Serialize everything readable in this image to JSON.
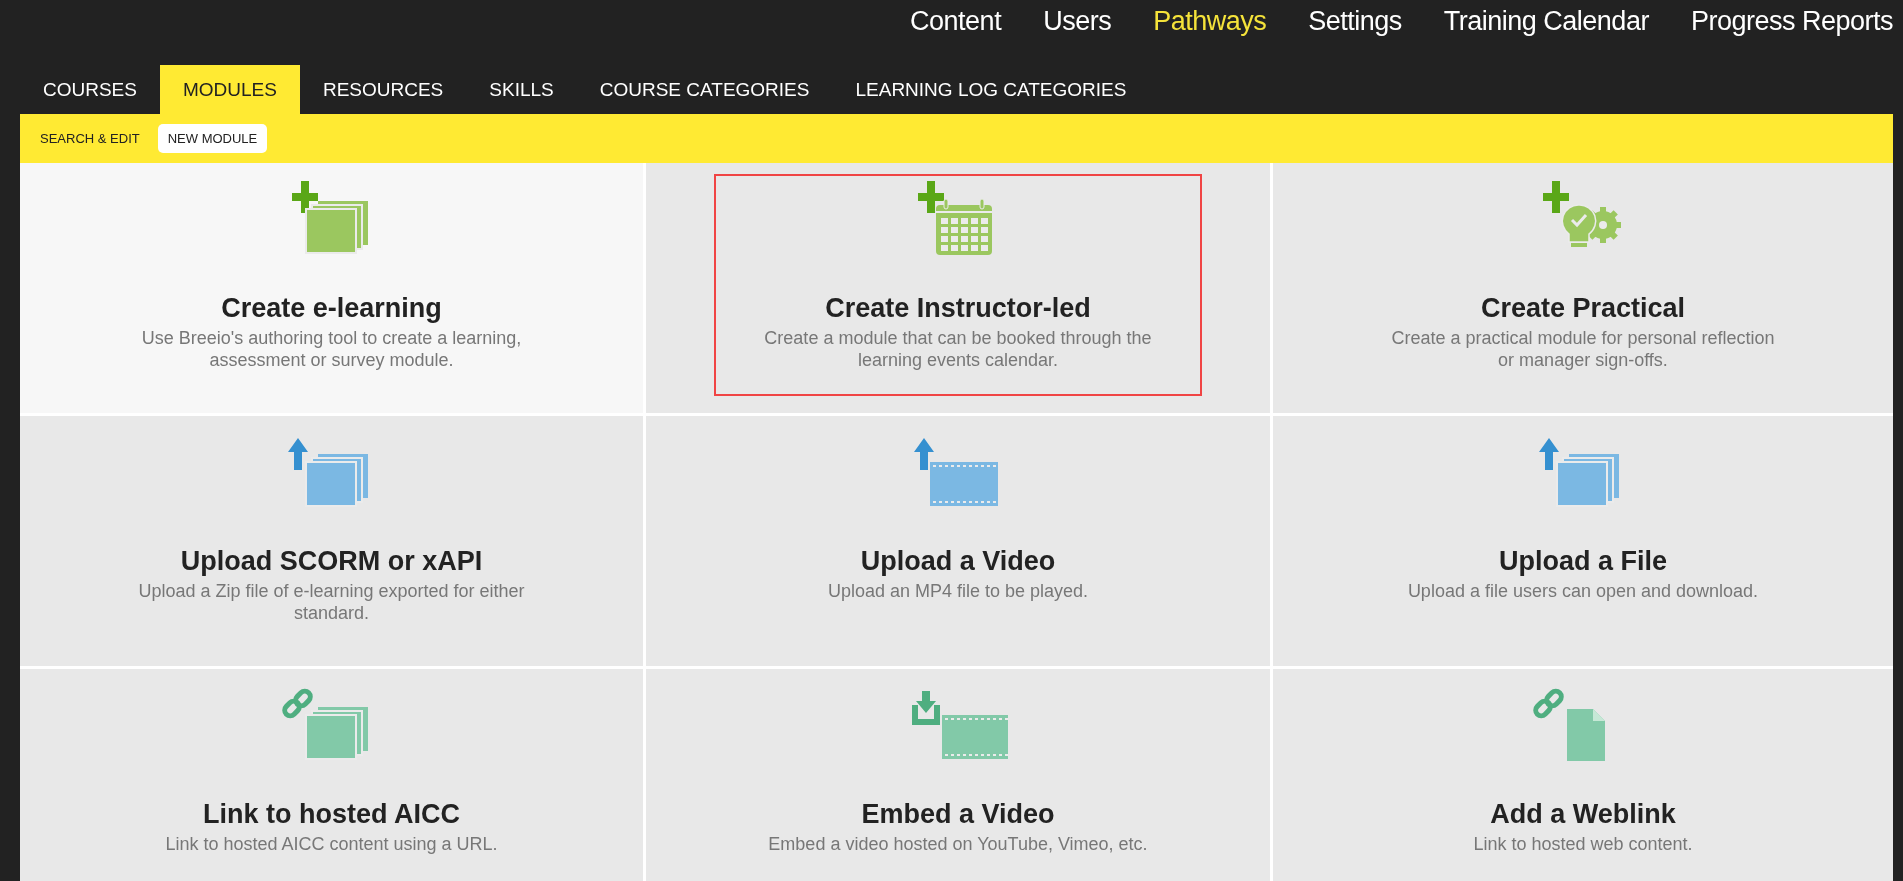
{
  "top_nav": [
    {
      "label": "Content",
      "selected": false
    },
    {
      "label": "Users",
      "selected": false
    },
    {
      "label": "Pathways",
      "selected": true
    },
    {
      "label": "Settings",
      "selected": false
    },
    {
      "label": "Training Calendar",
      "selected": false
    },
    {
      "label": "Progress Reports",
      "selected": false
    }
  ],
  "tabs": [
    {
      "label": "COURSES",
      "selected": false
    },
    {
      "label": "MODULES",
      "selected": true
    },
    {
      "label": "RESOURCES",
      "selected": false
    },
    {
      "label": "SKILLS",
      "selected": false
    },
    {
      "label": "COURSE CATEGORIES",
      "selected": false
    },
    {
      "label": "LEARNING LOG CATEGORIES",
      "selected": false
    }
  ],
  "sub_tabs": [
    {
      "label": "SEARCH & EDIT",
      "selected": false
    },
    {
      "label": "NEW MODULE",
      "selected": true
    }
  ],
  "cards": [
    {
      "kind": "elearning",
      "title": "Create e-learning",
      "description": "Use Breeio's authoring tool to create a learning, assessment or survey module.",
      "hovered": true,
      "highlighted": false
    },
    {
      "kind": "instructor",
      "title": "Create Instructor-led",
      "description": "Create a module that can be booked through the learning events calendar.",
      "hovered": false,
      "highlighted": true
    },
    {
      "kind": "practical",
      "title": "Create Practical",
      "description": "Create a practical module for personal reflection or manager sign-offs.",
      "hovered": false,
      "highlighted": false
    },
    {
      "kind": "scorm",
      "title": "Upload SCORM or xAPI",
      "description": "Upload a Zip file of e-learning exported for either standard.",
      "hovered": false,
      "highlighted": false
    },
    {
      "kind": "video",
      "title": "Upload a Video",
      "description": "Upload an MP4 file to be played.",
      "hovered": false,
      "highlighted": false
    },
    {
      "kind": "file",
      "title": "Upload a File",
      "description": "Upload a file users can open and download.",
      "hovered": false,
      "highlighted": false
    },
    {
      "kind": "aicc",
      "title": "Link to hosted AICC",
      "description": "Link to hosted AICC content using a URL.",
      "hovered": false,
      "highlighted": false
    },
    {
      "kind": "embed",
      "title": "Embed a Video",
      "description": "Embed a video hosted on YouTube, Vimeo, etc.",
      "hovered": false,
      "highlighted": false
    },
    {
      "kind": "weblink",
      "title": "Add a Weblink",
      "description": "Link to hosted web content.",
      "hovered": false,
      "highlighted": false
    }
  ]
}
